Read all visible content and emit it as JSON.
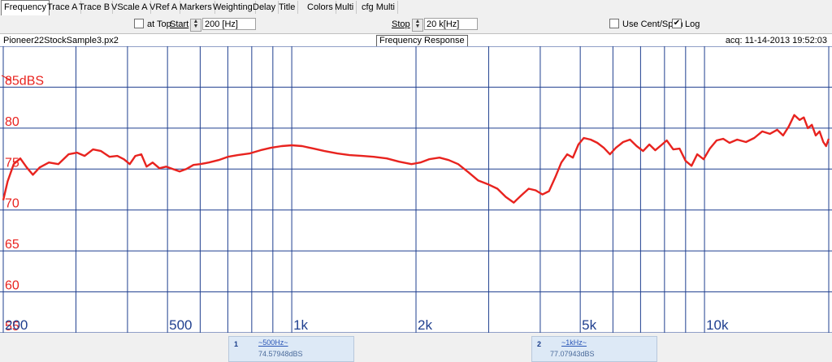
{
  "tabs": [
    "Frequency",
    "Trace A",
    "Trace B",
    "VScale A",
    "VRef A",
    "Markers",
    "Weighting",
    "Delay",
    "Title",
    "Colors",
    "Multi",
    "cfg Multi"
  ],
  "controls": {
    "at_top_label": "at Top",
    "start_label": "Start",
    "start_value": "200 [Hz]",
    "stop_label": "Stop",
    "stop_value": "20 k[Hz]",
    "use_cent_span_label": "Use Cent/Span",
    "log_label": "Log",
    "log_checked": true
  },
  "header": {
    "filename": "Pioneer22StockSample3.px2",
    "title": "Frequency Response",
    "acq": "acq: 11-14-2013 19:52:03"
  },
  "chart_data": {
    "type": "line",
    "title": "Frequency Response",
    "x_scale": "log",
    "xlim": [
      200,
      20000
    ],
    "ylim": [
      55,
      90
    ],
    "y_ticks": [
      {
        "value": 85,
        "label": "85dBS"
      },
      {
        "value": 80,
        "label": "80"
      },
      {
        "value": 75,
        "label": "75"
      },
      {
        "value": 70,
        "label": "70"
      },
      {
        "value": 65,
        "label": "65"
      },
      {
        "value": 60,
        "label": "60"
      },
      {
        "value": 55,
        "label": "55"
      }
    ],
    "x_ticks": [
      {
        "value": 200,
        "label": "200"
      },
      {
        "value": 500,
        "label": "500"
      },
      {
        "value": 1000,
        "label": "1k"
      },
      {
        "value": 2000,
        "label": "2k"
      },
      {
        "value": 5000,
        "label": "5k"
      },
      {
        "value": 10000,
        "label": "10k"
      }
    ],
    "grid": true,
    "series": [
      {
        "color": "#e8231f",
        "points": [
          [
            200,
            71.2
          ],
          [
            205,
            73.5
          ],
          [
            212,
            75.6
          ],
          [
            220,
            76.3
          ],
          [
            228,
            75.2
          ],
          [
            236,
            74.3
          ],
          [
            245,
            75.2
          ],
          [
            258,
            75.8
          ],
          [
            272,
            75.6
          ],
          [
            288,
            76.8
          ],
          [
            302,
            77.0
          ],
          [
            315,
            76.6
          ],
          [
            330,
            77.4
          ],
          [
            345,
            77.2
          ],
          [
            362,
            76.5
          ],
          [
            378,
            76.6
          ],
          [
            392,
            76.2
          ],
          [
            405,
            75.6
          ],
          [
            418,
            76.6
          ],
          [
            432,
            76.8
          ],
          [
            445,
            75.3
          ],
          [
            460,
            75.8
          ],
          [
            478,
            75.1
          ],
          [
            496,
            75.3
          ],
          [
            515,
            75.0
          ],
          [
            535,
            74.7
          ],
          [
            555,
            75.0
          ],
          [
            578,
            75.5
          ],
          [
            600,
            75.6
          ],
          [
            630,
            75.8
          ],
          [
            665,
            76.1
          ],
          [
            700,
            76.5
          ],
          [
            740,
            76.7
          ],
          [
            790,
            76.9
          ],
          [
            840,
            77.3
          ],
          [
            890,
            77.6
          ],
          [
            945,
            77.8
          ],
          [
            1000,
            77.9
          ],
          [
            1060,
            77.8
          ],
          [
            1130,
            77.5
          ],
          [
            1200,
            77.2
          ],
          [
            1290,
            76.9
          ],
          [
            1380,
            76.7
          ],
          [
            1480,
            76.6
          ],
          [
            1580,
            76.5
          ],
          [
            1700,
            76.3
          ],
          [
            1820,
            75.9
          ],
          [
            1950,
            75.6
          ],
          [
            2050,
            75.8
          ],
          [
            2150,
            76.2
          ],
          [
            2280,
            76.4
          ],
          [
            2400,
            76.1
          ],
          [
            2530,
            75.6
          ],
          [
            2680,
            74.6
          ],
          [
            2830,
            73.6
          ],
          [
            3000,
            73.1
          ],
          [
            3150,
            72.6
          ],
          [
            3300,
            71.6
          ],
          [
            3450,
            70.9
          ],
          [
            3600,
            71.8
          ],
          [
            3750,
            72.6
          ],
          [
            3900,
            72.4
          ],
          [
            4050,
            71.9
          ],
          [
            4200,
            72.3
          ],
          [
            4350,
            74.0
          ],
          [
            4500,
            75.8
          ],
          [
            4650,
            76.8
          ],
          [
            4800,
            76.4
          ],
          [
            4950,
            78.0
          ],
          [
            5100,
            78.8
          ],
          [
            5300,
            78.6
          ],
          [
            5500,
            78.2
          ],
          [
            5700,
            77.6
          ],
          [
            5900,
            76.8
          ],
          [
            6100,
            77.6
          ],
          [
            6350,
            78.3
          ],
          [
            6600,
            78.6
          ],
          [
            6850,
            77.8
          ],
          [
            7100,
            77.2
          ],
          [
            7350,
            78.0
          ],
          [
            7600,
            77.3
          ],
          [
            7850,
            77.9
          ],
          [
            8100,
            78.5
          ],
          [
            8400,
            77.4
          ],
          [
            8700,
            77.5
          ],
          [
            9000,
            76.0
          ],
          [
            9300,
            75.4
          ],
          [
            9600,
            76.8
          ],
          [
            9950,
            76.2
          ],
          [
            10300,
            77.5
          ],
          [
            10700,
            78.5
          ],
          [
            11100,
            78.7
          ],
          [
            11500,
            78.2
          ],
          [
            12000,
            78.6
          ],
          [
            12600,
            78.3
          ],
          [
            13200,
            78.8
          ],
          [
            13800,
            79.6
          ],
          [
            14400,
            79.3
          ],
          [
            15000,
            79.8
          ],
          [
            15500,
            79.1
          ],
          [
            16000,
            80.2
          ],
          [
            16500,
            81.6
          ],
          [
            17000,
            81.0
          ],
          [
            17400,
            81.3
          ],
          [
            17800,
            80.0
          ],
          [
            18200,
            80.4
          ],
          [
            18600,
            79.1
          ],
          [
            19000,
            79.6
          ],
          [
            19400,
            78.3
          ],
          [
            19700,
            77.8
          ],
          [
            20000,
            78.7
          ]
        ]
      }
    ]
  },
  "markers": [
    {
      "num": "1",
      "freq": "~500Hz~",
      "value": "74.57948dBS"
    },
    {
      "num": "2",
      "freq": "~1kHz~",
      "value": "77.07943dBS"
    }
  ]
}
